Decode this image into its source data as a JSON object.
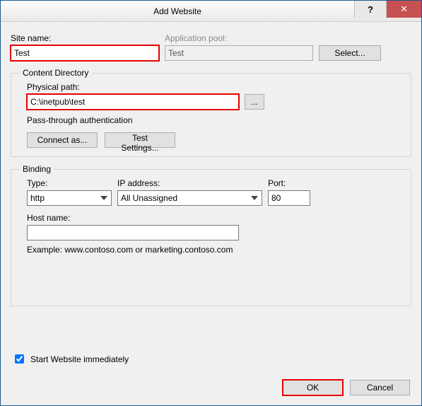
{
  "window": {
    "title": "Add Website"
  },
  "fields": {
    "site_name_label": "Site name:",
    "site_name_value": "Test",
    "app_pool_label": "Application pool:",
    "app_pool_value": "Test",
    "select_button": "Select..."
  },
  "content_dir": {
    "legend": "Content Directory",
    "physical_path_label": "Physical path:",
    "physical_path_value": "C:\\inetpub\\test",
    "browse_button": "...",
    "passthrough_label": "Pass-through authentication",
    "connect_as_button": "Connect as...",
    "test_settings_button": "Test Settings..."
  },
  "binding": {
    "legend": "Binding",
    "type_label": "Type:",
    "type_value": "http",
    "ip_label": "IP address:",
    "ip_value": "All Unassigned",
    "port_label": "Port:",
    "port_value": "80",
    "host_label": "Host name:",
    "host_value": "",
    "example": "Example: www.contoso.com or marketing.contoso.com"
  },
  "start_checkbox": {
    "label": "Start Website immediately",
    "checked": true
  },
  "footer": {
    "ok": "OK",
    "cancel": "Cancel"
  }
}
